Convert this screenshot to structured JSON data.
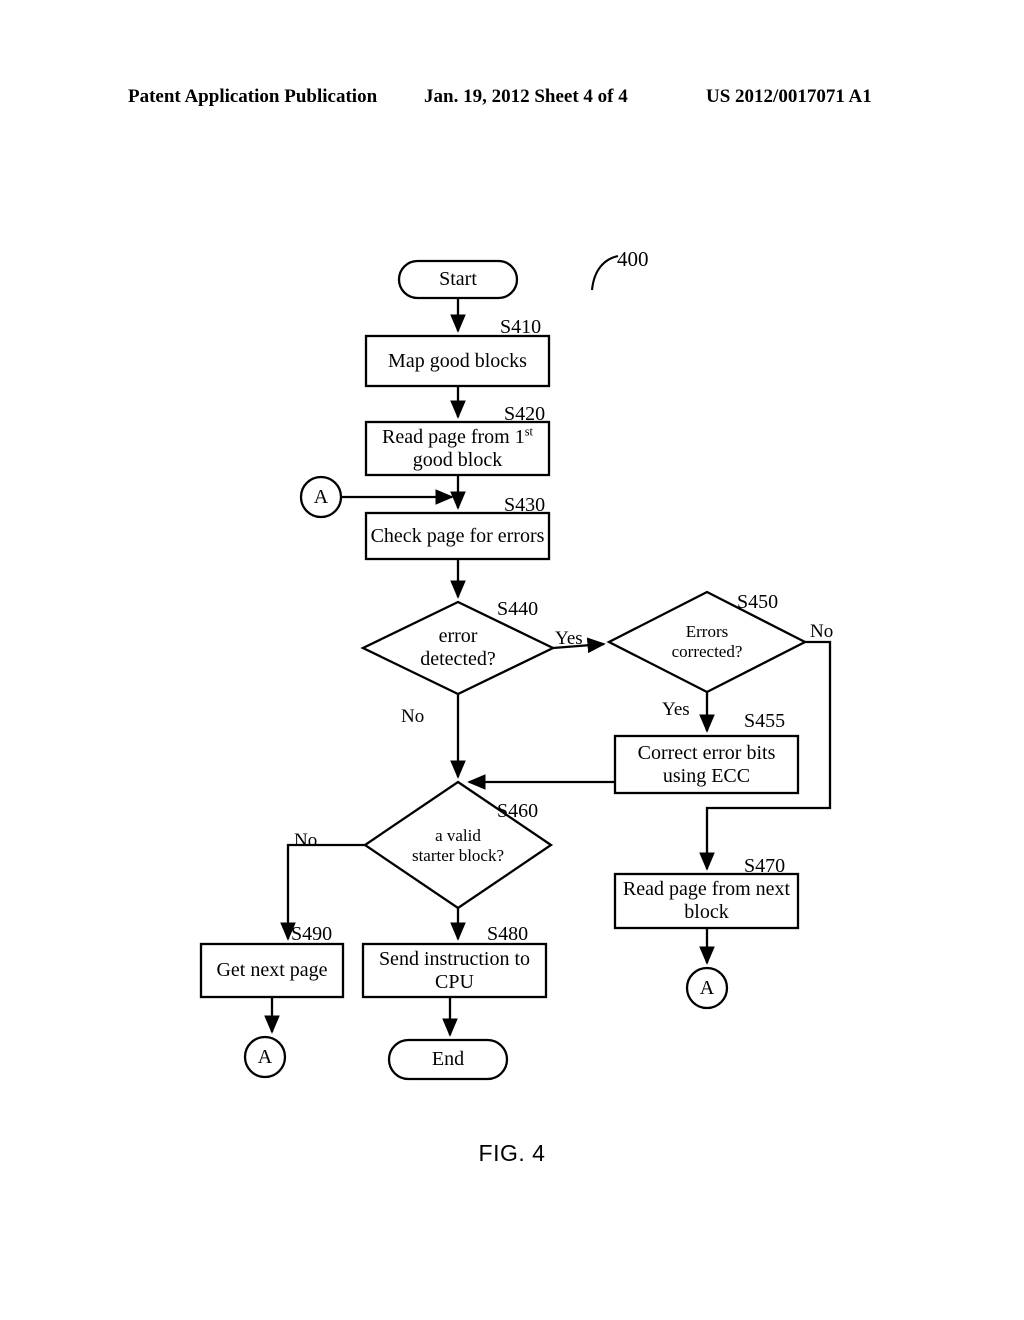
{
  "header": {
    "left": "Patent Application Publication",
    "middle": "Jan. 19, 2012  Sheet 4 of 4",
    "right": "US 2012/0017071 A1"
  },
  "figure": {
    "caption": "FIG. 4",
    "reference_numeral": "400"
  },
  "diagram": {
    "type": "flowchart",
    "nodes": {
      "start": {
        "label": "Start",
        "shape": "terminator"
      },
      "s410": {
        "label": "Map good blocks",
        "tag": "S410",
        "shape": "process"
      },
      "s420": {
        "label_part1": "Read page from 1",
        "label_sup": "st",
        "label_part2": "good block",
        "tag": "S420",
        "shape": "process"
      },
      "s430": {
        "label": "Check page for errors",
        "tag": "S430",
        "shape": "process"
      },
      "s440": {
        "label_line1": "error",
        "label_line2": "detected?",
        "tag": "S440",
        "shape": "decision"
      },
      "s450": {
        "label_line1": "Errors",
        "label_line2": "corrected?",
        "tag": "S450",
        "shape": "decision"
      },
      "s455": {
        "label_line1": "Correct error bits",
        "label_line2": "using ECC",
        "tag": "S455",
        "shape": "process"
      },
      "s460": {
        "label_line1": "a valid",
        "label_line2": "starter block?",
        "tag": "S460",
        "shape": "decision"
      },
      "s470": {
        "label_line1": "Read page from next",
        "label_line2": "block",
        "tag": "S470",
        "shape": "process"
      },
      "s480": {
        "label_line1": "Send instruction to",
        "label_line2": "CPU",
        "tag": "S480",
        "shape": "process"
      },
      "s490": {
        "label": "Get next page",
        "tag": "S490",
        "shape": "process"
      },
      "end": {
        "label": "End",
        "shape": "terminator"
      },
      "connector_left": {
        "label": "A",
        "shape": "connector"
      },
      "connector_bottom_left": {
        "label": "A",
        "shape": "connector"
      },
      "connector_bottom_right": {
        "label": "A",
        "shape": "connector"
      }
    },
    "edge_labels": {
      "s440_yes": "Yes",
      "s440_no": "No",
      "s450_no": "No",
      "s450_yes": "Yes",
      "s460_no": "No"
    },
    "colors": {
      "stroke": "#000000",
      "fill": "#ffffff",
      "background": "#ffffff"
    }
  }
}
